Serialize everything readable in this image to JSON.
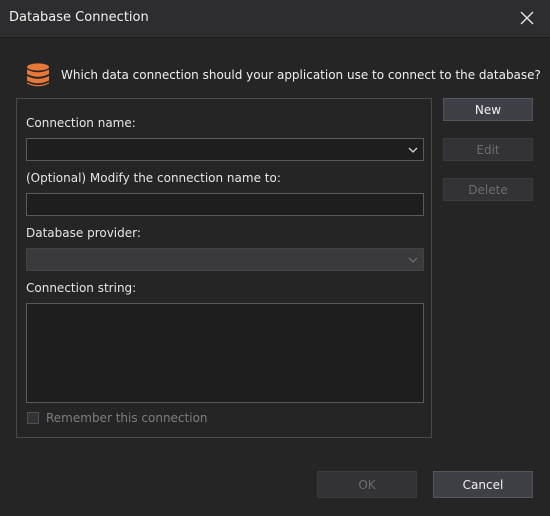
{
  "window": {
    "title": "Database Connection",
    "close_icon": "close-icon"
  },
  "prompt": {
    "icon": "database-icon",
    "icon_color": "#e8773a",
    "text": "Which data connection should your application use to connect to the database?"
  },
  "form": {
    "connection_name_label": "Connection name:",
    "connection_name_value": "",
    "modify_name_label": "(Optional) Modify the connection name to:",
    "modify_name_value": "",
    "provider_label": "Database provider:",
    "provider_value": "",
    "connection_string_label": "Connection string:",
    "connection_string_value": "",
    "remember_label": "Remember this connection",
    "remember_checked": false
  },
  "side_buttons": {
    "new_label": "New",
    "edit_label": "Edit",
    "delete_label": "Delete"
  },
  "footer": {
    "ok_label": "OK",
    "cancel_label": "Cancel"
  }
}
